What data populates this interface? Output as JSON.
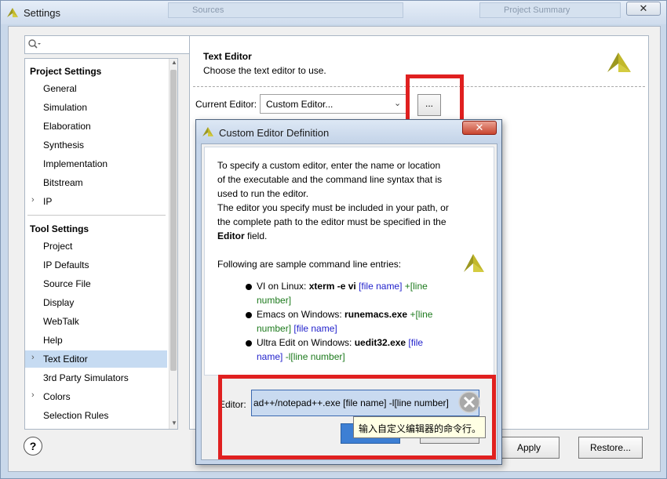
{
  "window": {
    "title": "Settings",
    "close_glyph": "✕",
    "background_tabs": [
      "Sources",
      "Project Summary"
    ]
  },
  "search": {
    "placeholder": ""
  },
  "tree": {
    "project_settings_header": "Project Settings",
    "project_items": [
      "General",
      "Simulation",
      "Elaboration",
      "Synthesis",
      "Implementation",
      "Bitstream",
      "IP"
    ],
    "tool_settings_header": "Tool Settings",
    "tool_items": [
      "Project",
      "IP Defaults",
      "Source File",
      "Display",
      "WebTalk",
      "Help",
      "Text Editor",
      "3rd Party Simulators",
      "Colors",
      "Selection Rules"
    ],
    "selected": "Text Editor",
    "expand_glyph": "›"
  },
  "panel": {
    "title": "Text Editor",
    "subtitle": "Choose the text editor to use.",
    "current_editor_label": "Current Editor:",
    "current_editor_value": "Custom Editor...",
    "browse_label": "...",
    "dropdown_glyph": "⌄"
  },
  "footer": {
    "help_label": "?",
    "apply_label": "Apply",
    "restore_label": "Restore..."
  },
  "dialog": {
    "title": "Custom Editor Definition",
    "close_glyph": "✕",
    "intro": [
      "To specify a custom editor, enter the name or location",
      "of the executable and the command line syntax that is",
      "used to run the editor.",
      "The editor you specify must be included in your path, or",
      "the complete path to the editor must be specified in the"
    ],
    "field_note_prefix": "",
    "field_note_bold": "Editor",
    "field_note_suffix": " field.",
    "samples_heading": "Following are sample command line entries:",
    "sample1": {
      "prefix": "VI on Linux: ",
      "bold": "xterm -e vi",
      "blue": " [file name]",
      "green1": " +[line",
      "green2": "number]"
    },
    "sample2": {
      "prefix": "Emacs on Windows: ",
      "bold": "runemacs.exe",
      "green1": " +[line",
      "green2": "number]",
      "blue": " [file name]"
    },
    "sample3": {
      "prefix": "Ultra Edit on Windows: ",
      "bold": "uedit32.exe",
      "blue1": " [file",
      "blue2": "name]",
      "green": " -l[line number]"
    },
    "editor_label": "Editor:",
    "editor_value": "ad++/notepad++.exe  [file name] -l[line number]",
    "tooltip": "输入自定义编辑器的命令行。"
  },
  "colors": {
    "highlight": "#e02020",
    "selection": "#c6dbf2",
    "keyword_blue": "#2222cc",
    "keyword_green": "#1d7a1d",
    "logo": "#b8b020"
  },
  "icons": {
    "app_logo": "xilinx-logo-icon",
    "search": "search-icon",
    "clear": "clear-x-icon",
    "help": "help-icon"
  }
}
